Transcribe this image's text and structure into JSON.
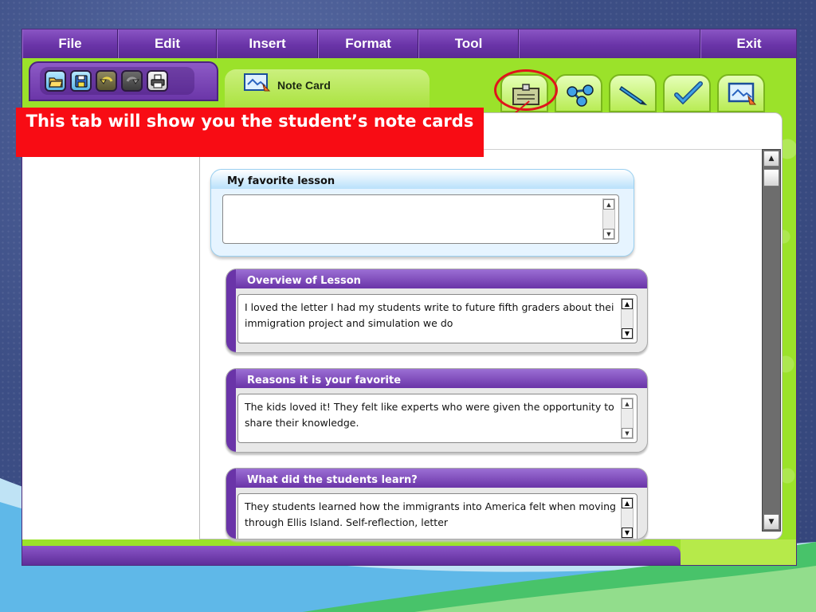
{
  "menu": {
    "file": "File",
    "edit": "Edit",
    "insert": "Insert",
    "format": "Format",
    "tool": "Tool",
    "exit": "Exit"
  },
  "doc_tab": {
    "label": "Note Card"
  },
  "callout": {
    "text": "This tab will show you the student’s note cards"
  },
  "cards": {
    "favorite": {
      "title": "My favorite lesson",
      "value": ""
    },
    "overview": {
      "title": "Overview of Lesson",
      "value": "I loved the letter I had my students write to future fifth graders about thei immigration project and simulation we do"
    },
    "reasons": {
      "title": "Reasons it is your favorite",
      "value": "The kids loved it! They felt like experts who were given the opportunity to share their knowledge."
    },
    "learn": {
      "title": "What did the students learn?",
      "value": "They students learned how the immigrants into America felt when moving through Ellis Island. Self-reflection, letter"
    }
  },
  "colors": {
    "menu_purple": "#6a34a8",
    "app_green": "#9be22a",
    "callout_red": "#f80c14",
    "highlight_ring": "#e0151b"
  },
  "icons": {
    "toolbar": [
      "open-folder-icon",
      "save-disk-icon",
      "undo-icon",
      "redo-icon",
      "print-icon"
    ],
    "tabs": [
      "note-card-icon",
      "graphic-organizer-icon",
      "pencil-icon",
      "checkmark-icon",
      "presentation-icon"
    ]
  }
}
